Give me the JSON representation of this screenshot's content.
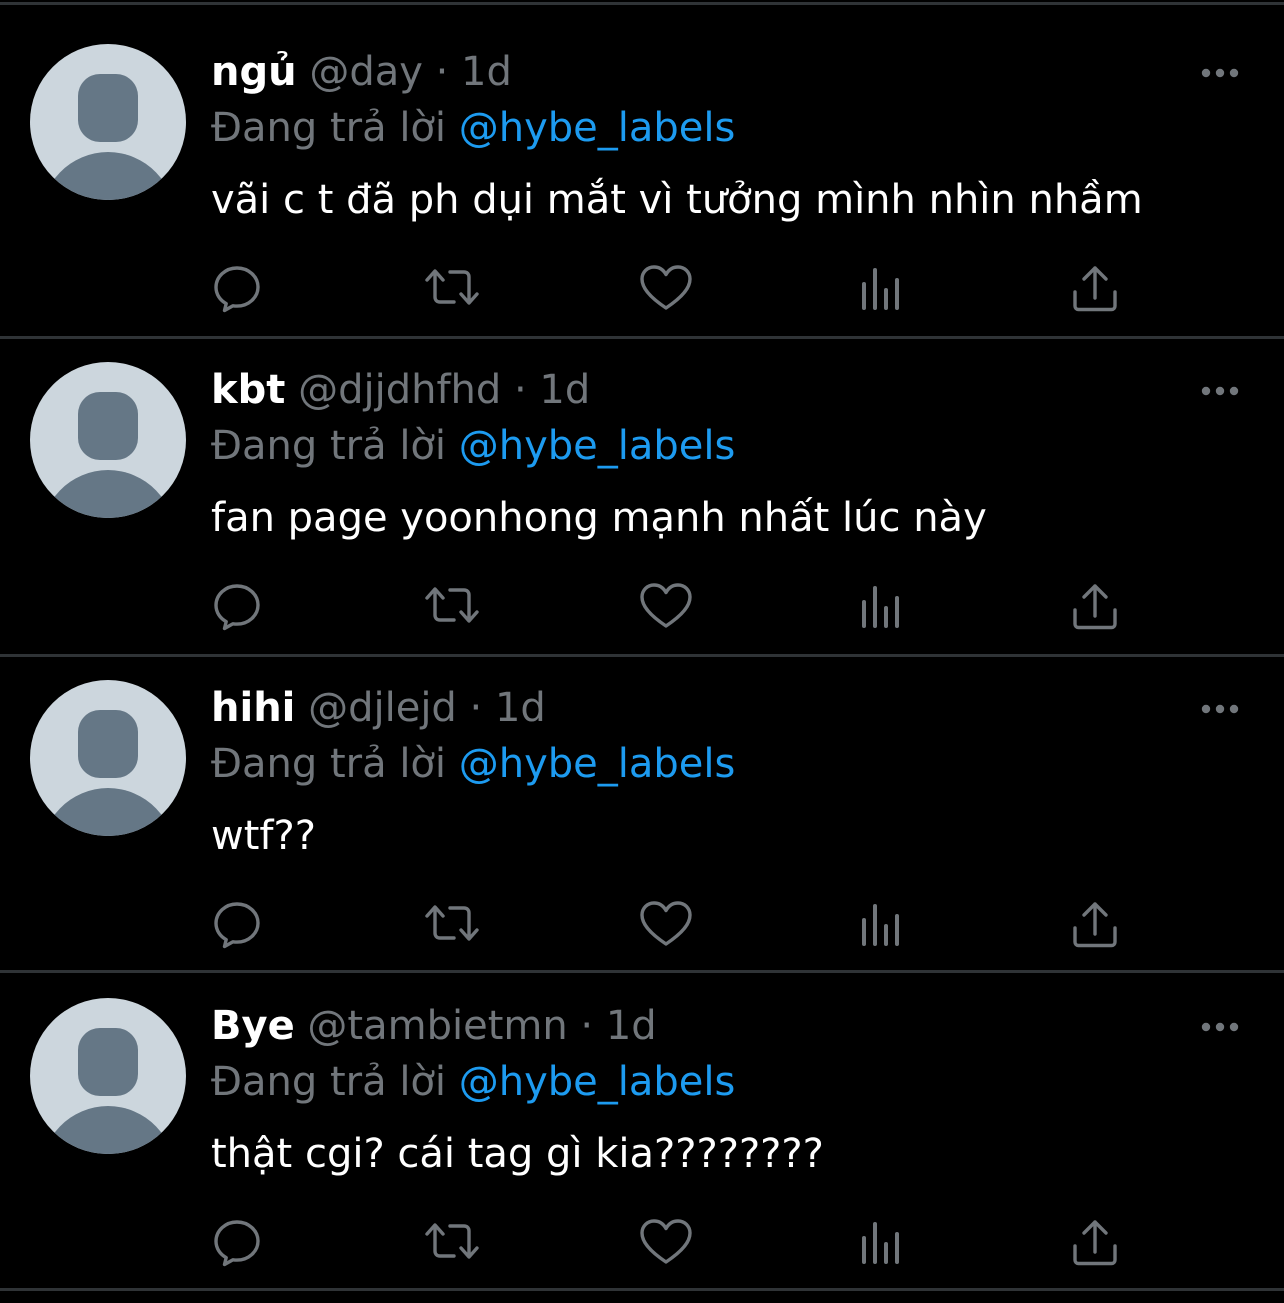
{
  "tweets": [
    {
      "display_name": "ngủ",
      "handle": "@day",
      "separator": "·",
      "time": "1d",
      "reply_prefix": "Đang trả lời",
      "reply_to": "@hybe_labels",
      "text": "vãi c t đã ph dụi mắt vì tưởng mình nhìn nhầm"
    },
    {
      "display_name": "kbt",
      "handle": "@djjdhfhd",
      "separator": "·",
      "time": "1d",
      "reply_prefix": "Đang trả lời",
      "reply_to": "@hybe_labels",
      "text": "fan page yoonhong mạnh nhất lúc này"
    },
    {
      "display_name": "hihi",
      "handle": "@djlejd",
      "separator": "·",
      "time": "1d",
      "reply_prefix": "Đang trả lời",
      "reply_to": "@hybe_labels",
      "text": "wtf??"
    },
    {
      "display_name": "Bye",
      "handle": "@tambietmn",
      "separator": "·",
      "time": "1d",
      "reply_prefix": "Đang trả lời",
      "reply_to": "@hybe_labels",
      "text": "thật cgi? cái tag gì kia????????"
    }
  ],
  "icons": {
    "avatar": "default-avatar-icon",
    "more": "more-horizontal-icon",
    "reply": "reply-icon",
    "retweet": "retweet-icon",
    "like": "like-icon",
    "views": "views-icon",
    "share": "share-icon"
  },
  "colors": {
    "background": "#000000",
    "text": "#ffffff",
    "secondary_text": "#71767b",
    "accent": "#1d9bf0",
    "divider": "#2f3336",
    "icon": "#71767b",
    "avatar_bg": "#ccd6dd",
    "avatar_figure": "#657786"
  }
}
